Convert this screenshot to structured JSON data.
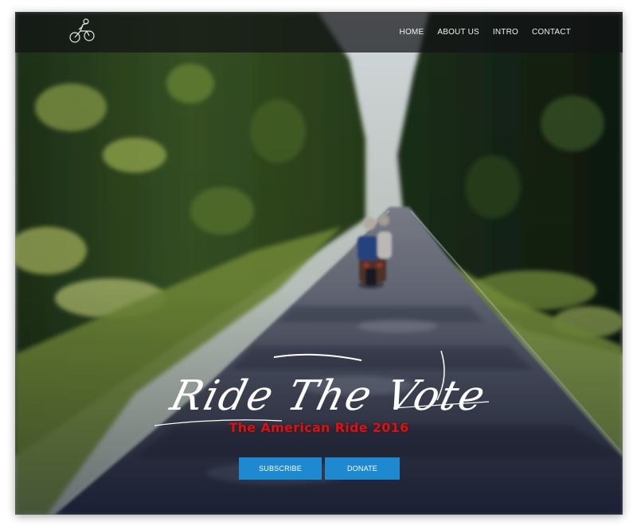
{
  "nav": {
    "logo_icon": "motorcycle-rider-icon",
    "items": [
      {
        "label": "HOME"
      },
      {
        "label": "ABOUT US"
      },
      {
        "label": "INTRO"
      },
      {
        "label": "CONTACT"
      }
    ]
  },
  "hero": {
    "title": "Ride The Vote",
    "subtitle": "The American Ride 2016",
    "buttons": {
      "subscribe_label": "SUBSCRIBE",
      "donate_label": "DONATE"
    }
  },
  "colors": {
    "button": "#1e88d0",
    "subtitle": "#e01010",
    "nav_bg": "#121416"
  }
}
